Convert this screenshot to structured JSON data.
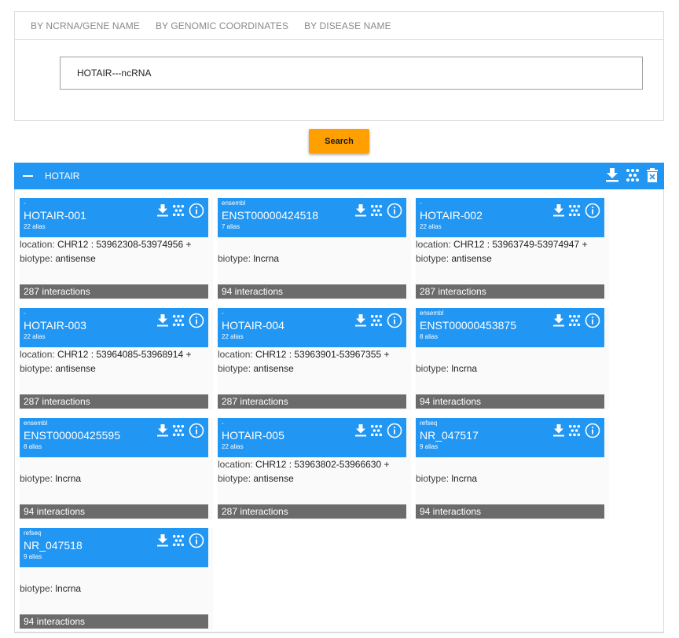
{
  "tabs": [
    "BY NCRNA/GENE NAME",
    "BY GENOMIC COORDINATES",
    "BY DISEASE NAME"
  ],
  "search": {
    "value": "HOTAIR---ncRNA"
  },
  "search_button": "Search",
  "result": {
    "title": "HOTAIR"
  },
  "labels": {
    "location": "location: ",
    "biotype": "biotype: "
  },
  "icons": {
    "download": "download-icon",
    "network": "network-icon",
    "info": "info-icon",
    "delete": "delete-icon",
    "collapse": "collapse-icon"
  },
  "colors": {
    "primary": "#2196f3",
    "accent": "#ffa000",
    "footer": "#6b6b6b"
  },
  "cards": [
    {
      "source": "-",
      "name": "HOTAIR-001",
      "alias": "22 alias",
      "location": "CHR12 : 53962308-53974956 +",
      "biotype": "antisense",
      "interactions": "287 interactions"
    },
    {
      "source": "ensembl",
      "name": "ENST00000424518",
      "alias": "7 alias",
      "location": "",
      "biotype": "lncrna",
      "interactions": "94 interactions"
    },
    {
      "source": "-",
      "name": "HOTAIR-002",
      "alias": "22 alias",
      "location": "CHR12 : 53963749-53974947 +",
      "biotype": "antisense",
      "interactions": "287 interactions"
    },
    {
      "source": "-",
      "name": "HOTAIR-003",
      "alias": "22 alias",
      "location": "CHR12 : 53964085-53968914 +",
      "biotype": "antisense",
      "interactions": "287 interactions"
    },
    {
      "source": "-",
      "name": "HOTAIR-004",
      "alias": "22 alias",
      "location": "CHR12 : 53963901-53967355 +",
      "biotype": "antisense",
      "interactions": "287 interactions"
    },
    {
      "source": "ensembl",
      "name": "ENST00000453875",
      "alias": "8 alias",
      "location": "",
      "biotype": "lncrna",
      "interactions": "94 interactions"
    },
    {
      "source": "ensembl",
      "name": "ENST00000425595",
      "alias": "8 alias",
      "location": "",
      "biotype": "lncrna",
      "interactions": "94 interactions"
    },
    {
      "source": "-",
      "name": "HOTAIR-005",
      "alias": "22 alias",
      "location": "CHR12 : 53963802-53966630 +",
      "biotype": "antisense",
      "interactions": "287 interactions"
    },
    {
      "source": "refseq",
      "name": "NR_047517",
      "alias": "9 alias",
      "location": "",
      "biotype": "lncrna",
      "interactions": "94 interactions"
    },
    {
      "source": "refseq",
      "name": "NR_047518",
      "alias": "9 alias",
      "location": "",
      "biotype": "lncrna",
      "interactions": "94 interactions"
    }
  ]
}
